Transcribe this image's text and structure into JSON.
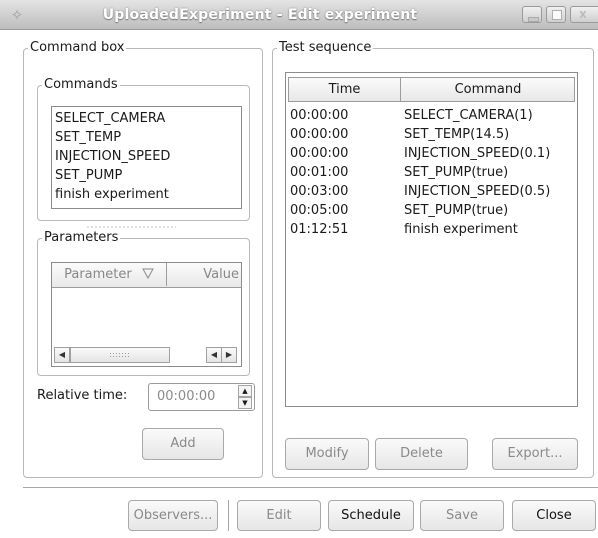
{
  "window": {
    "title": "UploadedExperiment - Edit experiment"
  },
  "command_box": {
    "legend": "Command box",
    "commands_legend": "Commands",
    "commands": [
      "SELECT_CAMERA",
      "SET_TEMP",
      "INJECTION_SPEED",
      "SET_PUMP",
      "finish experiment"
    ],
    "parameters_legend": "Parameters",
    "param_columns": [
      "Parameter",
      "Value"
    ],
    "relative_time_label": "Relative time:",
    "relative_time_value": "00:00:00",
    "add_label": "Add"
  },
  "test_sequence": {
    "legend": "Test sequence",
    "columns": [
      "Time",
      "Command"
    ],
    "rows": [
      {
        "time": "00:00:00",
        "command": "SELECT_CAMERA(1)"
      },
      {
        "time": "00:00:00",
        "command": "SET_TEMP(14.5)"
      },
      {
        "time": "00:00:00",
        "command": "INJECTION_SPEED(0.1)"
      },
      {
        "time": "00:01:00",
        "command": "SET_PUMP(true)"
      },
      {
        "time": "00:03:00",
        "command": "INJECTION_SPEED(0.5)"
      },
      {
        "time": "00:05:00",
        "command": "SET_PUMP(true)"
      },
      {
        "time": "01:12:51",
        "command": "finish experiment"
      }
    ],
    "modify_label": "Modify",
    "delete_label": "Delete",
    "export_label": "Export..."
  },
  "footer": {
    "observers_label": "Observers...",
    "edit_label": "Edit",
    "schedule_label": "Schedule",
    "save_label": "Save",
    "close_label": "Close"
  }
}
